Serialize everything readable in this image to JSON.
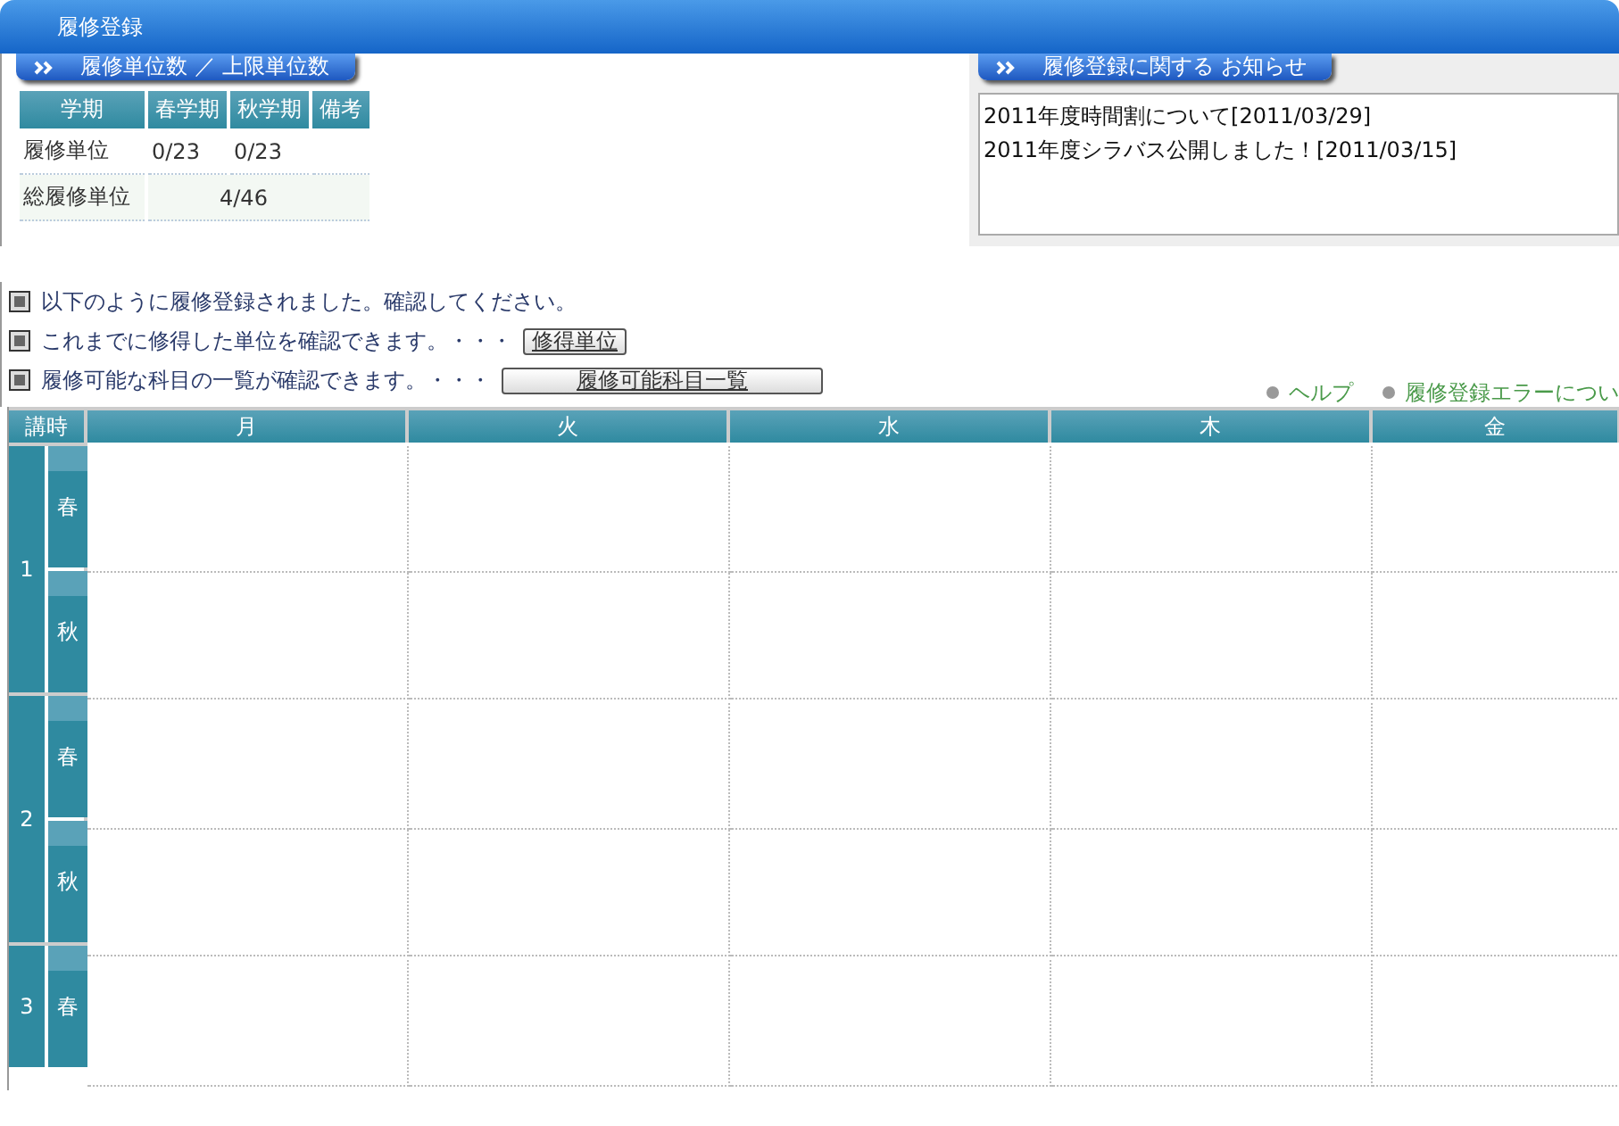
{
  "window": {
    "title": "履修登録"
  },
  "credits": {
    "heading": "履修単位数 ／ 上限単位数",
    "columns": [
      "学期",
      "春学期",
      "秋学期",
      "備考"
    ],
    "rows": [
      {
        "label": "履修単位",
        "cells": [
          "0/23",
          "0/23",
          ""
        ]
      },
      {
        "label": "総履修単位",
        "total": "4/46"
      }
    ]
  },
  "notices": {
    "heading": "履修登録に関する お知らせ",
    "items": [
      "2011年度時間割について[2011/03/29]",
      "2011年度シラバス公開しました！[2011/03/15]"
    ]
  },
  "messages": [
    {
      "text": "以下のように履修登録されました。確認してください。"
    },
    {
      "text": "これまでに修得した単位を確認できます。・・・",
      "button": "修得単位",
      "wide": false
    },
    {
      "text": "履修可能な科目の一覧が確認できます。・・・",
      "button": "履修可能科目一覧",
      "wide": true
    }
  ],
  "links": [
    "ヘルプ",
    "履修登録エラーについ"
  ],
  "timetable": {
    "corner": "講時",
    "days": [
      "月",
      "火",
      "水",
      "木",
      "金"
    ],
    "periods": [
      {
        "number": "1",
        "terms": [
          "春",
          "秋"
        ]
      },
      {
        "number": "2",
        "terms": [
          "春",
          "秋"
        ]
      },
      {
        "number": "3",
        "terms": [
          "春"
        ]
      }
    ]
  }
}
